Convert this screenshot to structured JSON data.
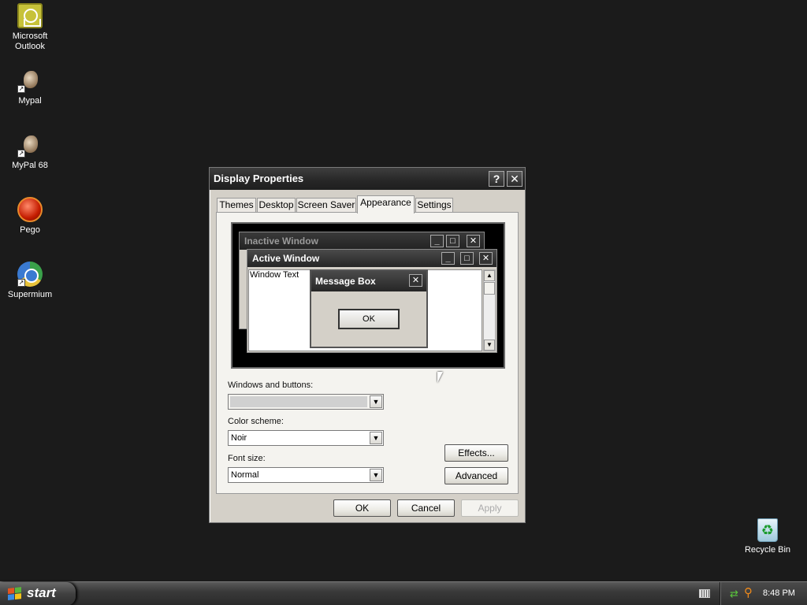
{
  "desktop": {
    "icons": [
      {
        "label": "Microsoft Outlook",
        "icon": "outlook-icon"
      },
      {
        "label": "Mypal",
        "icon": "mypal-icon"
      },
      {
        "label": "MyPal 68",
        "icon": "mypal-icon"
      },
      {
        "label": "Pego",
        "icon": "pego-icon"
      },
      {
        "label": "Supermium",
        "icon": "supermium-icon"
      },
      {
        "label": "Recycle Bin",
        "icon": "recycle-bin-icon"
      }
    ]
  },
  "dialog": {
    "title": "Display Properties",
    "help_glyph": "?",
    "close_glyph": "✕",
    "tabs": [
      "Themes",
      "Desktop",
      "Screen Saver",
      "Appearance",
      "Settings"
    ],
    "active_tab": "Appearance",
    "preview": {
      "inactive_title": "Inactive Window",
      "active_title": "Active Window",
      "window_text": "Window Text",
      "message_title": "Message Box",
      "message_ok": "OK"
    },
    "windows_and_buttons_label": "Windows and buttons:",
    "windows_and_buttons_value": "",
    "color_scheme_label": "Color scheme:",
    "color_scheme_value": "Noir",
    "font_size_label": "Font size:",
    "font_size_value": "Normal",
    "effects_label": "Effects...",
    "advanced_label": "Advanced",
    "ok_label": "OK",
    "cancel_label": "Cancel",
    "apply_label": "Apply"
  },
  "taskbar": {
    "start_label": "start",
    "clock": "8:48 PM"
  },
  "colors": {
    "desktop_bg": "#1b1b1b",
    "titlebar": "#262626",
    "dialog_face": "#d4d0c8"
  }
}
